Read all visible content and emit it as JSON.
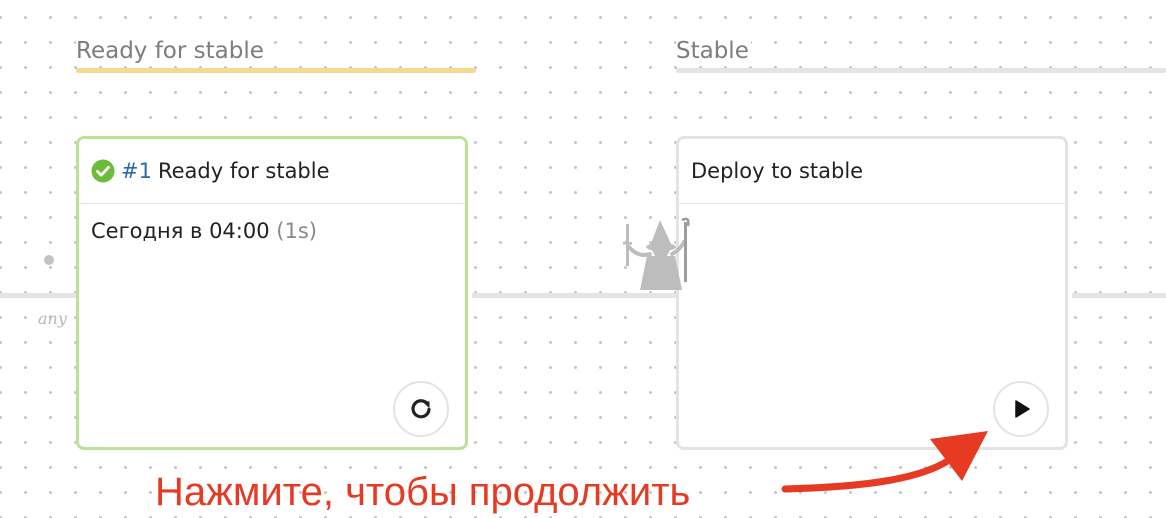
{
  "stages": [
    {
      "title": "Ready for stable",
      "bar_color": "#f5d98c"
    },
    {
      "title": "Stable",
      "bar_color": "#e4e4e4"
    }
  ],
  "flow": {
    "entry_label": "any"
  },
  "jobs": [
    {
      "status": "success",
      "status_icon": "check-circle-icon",
      "run_number": "#1",
      "title": "Ready for stable",
      "time": "Сегодня в 04:00",
      "duration": "(1s)",
      "action_icon": "restart-icon"
    },
    {
      "status": "idle",
      "title": "Deploy to stable",
      "action_icon": "play-icon"
    }
  ],
  "hint": {
    "text": "Нажмите, чтобы продолжить",
    "color": "#e63a23"
  },
  "colors": {
    "success_border": "#bde196",
    "idle_border": "#e3e3e3",
    "check": "#6dbb3a",
    "run_number": "#2f6aa8"
  }
}
